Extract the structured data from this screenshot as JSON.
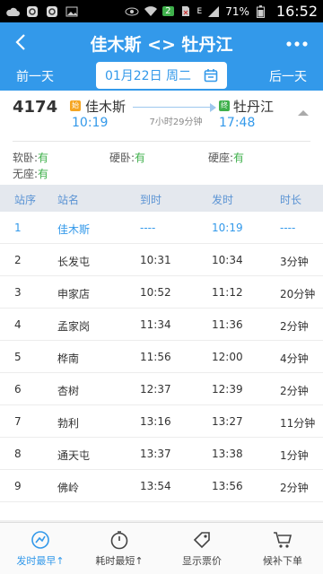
{
  "status_bar": {
    "battery": "71%",
    "time": "16:52",
    "badge": "2",
    "network": "E"
  },
  "header": {
    "title": "佳木斯 <> 牡丹江",
    "prev_day": "前一天",
    "next_day": "后一天",
    "date": "01月22日 周二",
    "accent": "#3399ea"
  },
  "train": {
    "number": "4174",
    "from_badge": "始",
    "from_station": "佳木斯",
    "from_time": "10:19",
    "to_badge": "终",
    "to_station": "牡丹江",
    "to_time": "17:48",
    "duration": "7小时29分钟"
  },
  "seats": [
    {
      "label": "软卧:",
      "value": "有"
    },
    {
      "label": "硬卧:",
      "value": "有"
    },
    {
      "label": "硬座:",
      "value": "有"
    },
    {
      "label": "无座:",
      "value": "有"
    }
  ],
  "table": {
    "headers": [
      "站序",
      "站名",
      "到时",
      "发时",
      "时长"
    ],
    "rows": [
      [
        "1",
        "佳木斯",
        "----",
        "10:19",
        "----"
      ],
      [
        "2",
        "长发屯",
        "10:31",
        "10:34",
        "3分钟"
      ],
      [
        "3",
        "申家店",
        "10:52",
        "11:12",
        "20分钟"
      ],
      [
        "4",
        "孟家岗",
        "11:34",
        "11:36",
        "2分钟"
      ],
      [
        "5",
        "桦南",
        "11:56",
        "12:00",
        "4分钟"
      ],
      [
        "6",
        "杏树",
        "12:37",
        "12:39",
        "2分钟"
      ],
      [
        "7",
        "勃利",
        "13:16",
        "13:27",
        "11分钟"
      ],
      [
        "8",
        "通天屯",
        "13:37",
        "13:38",
        "1分钟"
      ],
      [
        "9",
        "佛岭",
        "13:54",
        "13:56",
        "2分钟"
      ]
    ]
  },
  "bottom_nav": [
    {
      "label": "发时最早↑",
      "icon": "earliest-departure-icon"
    },
    {
      "label": "耗时最短↑",
      "icon": "shortest-duration-icon"
    },
    {
      "label": "显示票价",
      "icon": "price-tag-icon"
    },
    {
      "label": "候补下单",
      "icon": "cart-icon"
    }
  ]
}
